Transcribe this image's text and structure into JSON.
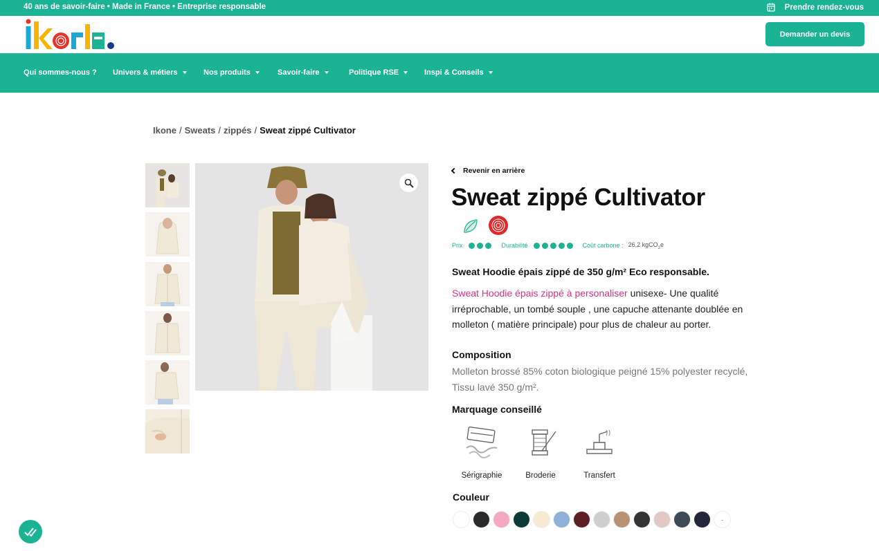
{
  "topbar": {
    "tagline": "40 ans de savoir-faire • Made in France • Entreprise responsable",
    "appointment": "Prendre rendez-vous"
  },
  "header": {
    "logo_text": "ikone",
    "quote_button": "Demander un devis"
  },
  "nav": {
    "items": [
      {
        "label": "Qui sommes-nous ?",
        "dropdown": false
      },
      {
        "label": "Univers & métiers",
        "dropdown": true
      },
      {
        "label": "Nos produits",
        "dropdown": true
      },
      {
        "label": "Savoir-faire",
        "dropdown": true
      },
      {
        "label": "Politique RSE",
        "dropdown": true
      },
      {
        "label": "Inspi & Conseils",
        "dropdown": true
      }
    ]
  },
  "breadcrumb": {
    "items": [
      "Ikone",
      "Sweats",
      "zippés"
    ],
    "separator": "/",
    "current": "Sweat zippé Cultivator"
  },
  "product": {
    "back_label": "Revenir en arrière",
    "title": "Sweat zippé Cultivator",
    "badges": [
      "leaf-icon",
      "fingerprint-icon"
    ],
    "metrics": {
      "price_label": "Prix",
      "price_level": 3,
      "durability_label": "Durabilité",
      "durability_level": 5,
      "carbon_label": "Coût carbone :",
      "carbon_value": "26,2 kgCO",
      "carbon_sub": "2",
      "carbon_suffix": "e"
    },
    "subtitle": "Sweat Hoodie épais zippé de 350 g/m² Eco responsable.",
    "desc_link": "Sweat Hoodie épais zippé à personaliser",
    "desc_rest": " unisexe- Une qualité irréprochable, un tombé souple , une capuche attenante doublée en molleton ( matière principale) pour plus de chaleur au porter.",
    "composition_heading": "Composition",
    "composition_text": "Molleton brossé 85% coton biologique peigné 15% polyester recyclé, Tissu lavé 350 g/m².",
    "marking_heading": "Marquage conseillé",
    "marking": [
      {
        "label": "Sérigraphie",
        "icon": "screen-printing-icon"
      },
      {
        "label": "Broderie",
        "icon": "embroidery-icon"
      },
      {
        "label": "Transfert",
        "icon": "heat-transfer-icon"
      }
    ],
    "color_heading": "Couleur",
    "colors": [
      "#ffffff",
      "#2a2a2a",
      "#f5a9c0",
      "#0c3b37",
      "#f7ead3",
      "#8fb0d8",
      "#5e1e25",
      "#cfcfcf",
      "#b89273",
      "#333333",
      "#e2c9c6",
      "#3e4a56",
      "#23253a"
    ],
    "colors_more": "-"
  }
}
